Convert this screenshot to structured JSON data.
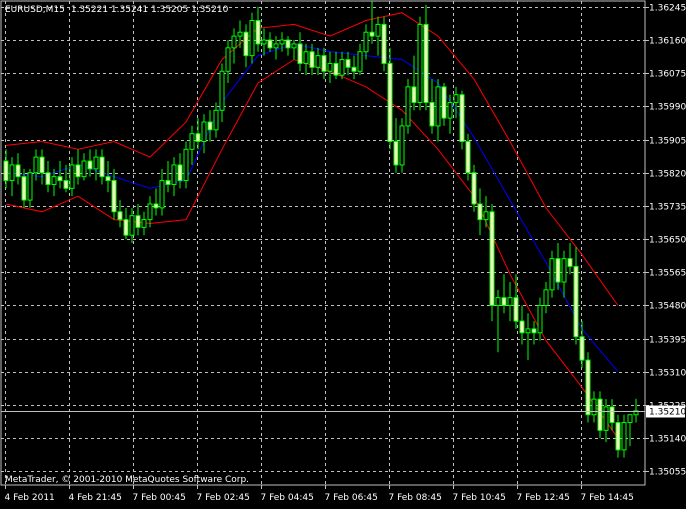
{
  "header": {
    "symbol": "EURUSD,M15",
    "ohlc": "1.35221 1.35241 1.35205 1.35210"
  },
  "copyright": "MetaTrader, © 2001-2010 MetaQuotes Software Corp.",
  "colors": {
    "background": "#000000",
    "grid": "#c0c0c0",
    "candle_bull": "#000000",
    "candle_bear": "#ffffc8",
    "wick": "#00ff00",
    "band": "#ff0000",
    "middle": "#0000ff",
    "axis_text": "#ffffff",
    "price_line": "#c0c0c0"
  },
  "chart_data": {
    "type": "candlestick",
    "grid": true,
    "ylim": [
      1.3502,
      1.3626
    ],
    "y_ticks": [
      "1.36245",
      "1.36160",
      "1.36075",
      "1.35990",
      "1.35905",
      "1.35820",
      "1.35735",
      "1.35650",
      "1.35565",
      "1.35480",
      "1.35395",
      "1.35310",
      "1.35225",
      "1.35140",
      "1.35055"
    ],
    "x_ticks": [
      "4 Feb 2011",
      "4 Feb 21:45",
      "7 Feb 00:45",
      "7 Feb 02:45",
      "7 Feb 04:45",
      "7 Feb 06:45",
      "7 Feb 08:45",
      "7 Feb 10:45",
      "7 Feb 12:45",
      "7 Feb 14:45"
    ],
    "current_price": "1.35210",
    "candles": [
      {
        "o": 1.3585,
        "h": 1.3588,
        "l": 1.3578,
        "c": 1.358
      },
      {
        "o": 1.358,
        "h": 1.3586,
        "l": 1.3576,
        "c": 1.3584
      },
      {
        "o": 1.3584,
        "h": 1.3587,
        "l": 1.3579,
        "c": 1.3581
      },
      {
        "o": 1.3581,
        "h": 1.3583,
        "l": 1.3573,
        "c": 1.3575
      },
      {
        "o": 1.3575,
        "h": 1.3583,
        "l": 1.3573,
        "c": 1.3582
      },
      {
        "o": 1.3582,
        "h": 1.3588,
        "l": 1.358,
        "c": 1.3586
      },
      {
        "o": 1.3586,
        "h": 1.3588,
        "l": 1.3579,
        "c": 1.3582
      },
      {
        "o": 1.3582,
        "h": 1.3585,
        "l": 1.3577,
        "c": 1.3579
      },
      {
        "o": 1.3579,
        "h": 1.3583,
        "l": 1.3576,
        "c": 1.3581
      },
      {
        "o": 1.3581,
        "h": 1.3585,
        "l": 1.3578,
        "c": 1.358
      },
      {
        "o": 1.358,
        "h": 1.3584,
        "l": 1.3577,
        "c": 1.3578
      },
      {
        "o": 1.3578,
        "h": 1.3586,
        "l": 1.3576,
        "c": 1.3584
      },
      {
        "o": 1.3584,
        "h": 1.3588,
        "l": 1.3579,
        "c": 1.3581
      },
      {
        "o": 1.3581,
        "h": 1.3587,
        "l": 1.358,
        "c": 1.3585
      },
      {
        "o": 1.3585,
        "h": 1.3588,
        "l": 1.3581,
        "c": 1.3583
      },
      {
        "o": 1.3583,
        "h": 1.3588,
        "l": 1.358,
        "c": 1.3586
      },
      {
        "o": 1.3586,
        "h": 1.3588,
        "l": 1.3579,
        "c": 1.3581
      },
      {
        "o": 1.3581,
        "h": 1.3585,
        "l": 1.3577,
        "c": 1.358
      },
      {
        "o": 1.358,
        "h": 1.3583,
        "l": 1.357,
        "c": 1.3572
      },
      {
        "o": 1.3572,
        "h": 1.3575,
        "l": 1.3568,
        "c": 1.357
      },
      {
        "o": 1.357,
        "h": 1.3573,
        "l": 1.3565,
        "c": 1.3566
      },
      {
        "o": 1.3566,
        "h": 1.3573,
        "l": 1.3564,
        "c": 1.3571
      },
      {
        "o": 1.3571,
        "h": 1.3574,
        "l": 1.3566,
        "c": 1.3568
      },
      {
        "o": 1.3568,
        "h": 1.3572,
        "l": 1.3566,
        "c": 1.357
      },
      {
        "o": 1.357,
        "h": 1.3576,
        "l": 1.3568,
        "c": 1.3574
      },
      {
        "o": 1.3574,
        "h": 1.3578,
        "l": 1.3571,
        "c": 1.3573
      },
      {
        "o": 1.3573,
        "h": 1.3583,
        "l": 1.3571,
        "c": 1.358
      },
      {
        "o": 1.358,
        "h": 1.3585,
        "l": 1.3577,
        "c": 1.3579
      },
      {
        "o": 1.3579,
        "h": 1.3586,
        "l": 1.3576,
        "c": 1.3584
      },
      {
        "o": 1.3584,
        "h": 1.3587,
        "l": 1.3578,
        "c": 1.358
      },
      {
        "o": 1.358,
        "h": 1.359,
        "l": 1.3578,
        "c": 1.3588
      },
      {
        "o": 1.3588,
        "h": 1.3594,
        "l": 1.3584,
        "c": 1.3592
      },
      {
        "o": 1.3592,
        "h": 1.3596,
        "l": 1.3588,
        "c": 1.359
      },
      {
        "o": 1.359,
        "h": 1.3597,
        "l": 1.3587,
        "c": 1.3595
      },
      {
        "o": 1.3595,
        "h": 1.3598,
        "l": 1.359,
        "c": 1.3593
      },
      {
        "o": 1.3593,
        "h": 1.36,
        "l": 1.3591,
        "c": 1.3598
      },
      {
        "o": 1.3598,
        "h": 1.361,
        "l": 1.3595,
        "c": 1.3608
      },
      {
        "o": 1.3608,
        "h": 1.3616,
        "l": 1.3605,
        "c": 1.3614
      },
      {
        "o": 1.3614,
        "h": 1.3619,
        "l": 1.361,
        "c": 1.3617
      },
      {
        "o": 1.3617,
        "h": 1.3621,
        "l": 1.3614,
        "c": 1.3618
      },
      {
        "o": 1.3618,
        "h": 1.362,
        "l": 1.3609,
        "c": 1.3612
      },
      {
        "o": 1.3612,
        "h": 1.3623,
        "l": 1.361,
        "c": 1.3621
      },
      {
        "o": 1.3621,
        "h": 1.36245,
        "l": 1.3613,
        "c": 1.3615
      },
      {
        "o": 1.3615,
        "h": 1.3619,
        "l": 1.3612,
        "c": 1.3616
      },
      {
        "o": 1.3616,
        "h": 1.3618,
        "l": 1.3613,
        "c": 1.3614
      },
      {
        "o": 1.3614,
        "h": 1.3617,
        "l": 1.3611,
        "c": 1.3615
      },
      {
        "o": 1.3615,
        "h": 1.3618,
        "l": 1.3613,
        "c": 1.3616
      },
      {
        "o": 1.3616,
        "h": 1.3617,
        "l": 1.3612,
        "c": 1.3614
      },
      {
        "o": 1.3614,
        "h": 1.3616,
        "l": 1.3611,
        "c": 1.3615
      },
      {
        "o": 1.3615,
        "h": 1.3618,
        "l": 1.3608,
        "c": 1.361
      },
      {
        "o": 1.361,
        "h": 1.3615,
        "l": 1.3607,
        "c": 1.3613
      },
      {
        "o": 1.3613,
        "h": 1.3615,
        "l": 1.3607,
        "c": 1.3609
      },
      {
        "o": 1.3609,
        "h": 1.3614,
        "l": 1.3607,
        "c": 1.3612
      },
      {
        "o": 1.3612,
        "h": 1.3614,
        "l": 1.3606,
        "c": 1.3608
      },
      {
        "o": 1.3608,
        "h": 1.3613,
        "l": 1.3605,
        "c": 1.361
      },
      {
        "o": 1.361,
        "h": 1.3613,
        "l": 1.3606,
        "c": 1.3607
      },
      {
        "o": 1.3607,
        "h": 1.3613,
        "l": 1.3606,
        "c": 1.3611
      },
      {
        "o": 1.3611,
        "h": 1.3613,
        "l": 1.3607,
        "c": 1.3609
      },
      {
        "o": 1.3609,
        "h": 1.3612,
        "l": 1.3606,
        "c": 1.3608
      },
      {
        "o": 1.3608,
        "h": 1.3615,
        "l": 1.3607,
        "c": 1.3613
      },
      {
        "o": 1.3613,
        "h": 1.362,
        "l": 1.3611,
        "c": 1.3618
      },
      {
        "o": 1.3618,
        "h": 1.3626,
        "l": 1.3615,
        "c": 1.3617
      },
      {
        "o": 1.3617,
        "h": 1.3622,
        "l": 1.3612,
        "c": 1.362
      },
      {
        "o": 1.362,
        "h": 1.3622,
        "l": 1.3608,
        "c": 1.361
      },
      {
        "o": 1.361,
        "h": 1.3614,
        "l": 1.3588,
        "c": 1.359
      },
      {
        "o": 1.359,
        "h": 1.3596,
        "l": 1.3582,
        "c": 1.3584
      },
      {
        "o": 1.3584,
        "h": 1.3596,
        "l": 1.3582,
        "c": 1.3594
      },
      {
        "o": 1.3594,
        "h": 1.3606,
        "l": 1.3592,
        "c": 1.3604
      },
      {
        "o": 1.3604,
        "h": 1.3612,
        "l": 1.3598,
        "c": 1.36
      },
      {
        "o": 1.36,
        "h": 1.3622,
        "l": 1.3598,
        "c": 1.362
      },
      {
        "o": 1.362,
        "h": 1.3625,
        "l": 1.3598,
        "c": 1.36
      },
      {
        "o": 1.36,
        "h": 1.3606,
        "l": 1.3592,
        "c": 1.3594
      },
      {
        "o": 1.3594,
        "h": 1.3606,
        "l": 1.359,
        "c": 1.3604
      },
      {
        "o": 1.3604,
        "h": 1.3605,
        "l": 1.3594,
        "c": 1.3596
      },
      {
        "o": 1.3596,
        "h": 1.3602,
        "l": 1.3592,
        "c": 1.36
      },
      {
        "o": 1.36,
        "h": 1.3604,
        "l": 1.3596,
        "c": 1.3602
      },
      {
        "o": 1.3602,
        "h": 1.3603,
        "l": 1.3588,
        "c": 1.359
      },
      {
        "o": 1.359,
        "h": 1.3592,
        "l": 1.358,
        "c": 1.3582
      },
      {
        "o": 1.3582,
        "h": 1.3584,
        "l": 1.3572,
        "c": 1.3574
      },
      {
        "o": 1.3574,
        "h": 1.3578,
        "l": 1.3566,
        "c": 1.357
      },
      {
        "o": 1.357,
        "h": 1.3576,
        "l": 1.3568,
        "c": 1.3572
      },
      {
        "o": 1.3572,
        "h": 1.3574,
        "l": 1.3544,
        "c": 1.3548
      },
      {
        "o": 1.3548,
        "h": 1.3552,
        "l": 1.3536,
        "c": 1.355
      },
      {
        "o": 1.355,
        "h": 1.3556,
        "l": 1.3546,
        "c": 1.3548
      },
      {
        "o": 1.3548,
        "h": 1.3554,
        "l": 1.3544,
        "c": 1.355
      },
      {
        "o": 1.355,
        "h": 1.3556,
        "l": 1.3542,
        "c": 1.3544
      },
      {
        "o": 1.3544,
        "h": 1.3548,
        "l": 1.3538,
        "c": 1.3541
      },
      {
        "o": 1.3541,
        "h": 1.3546,
        "l": 1.3534,
        "c": 1.3542
      },
      {
        "o": 1.3542,
        "h": 1.3544,
        "l": 1.3538,
        "c": 1.3541
      },
      {
        "o": 1.3541,
        "h": 1.355,
        "l": 1.3539,
        "c": 1.3548
      },
      {
        "o": 1.3548,
        "h": 1.3554,
        "l": 1.3546,
        "c": 1.3552
      },
      {
        "o": 1.3552,
        "h": 1.3562,
        "l": 1.355,
        "c": 1.356
      },
      {
        "o": 1.356,
        "h": 1.3564,
        "l": 1.3552,
        "c": 1.3554
      },
      {
        "o": 1.3554,
        "h": 1.3562,
        "l": 1.355,
        "c": 1.356
      },
      {
        "o": 1.356,
        "h": 1.3564,
        "l": 1.3556,
        "c": 1.3558
      },
      {
        "o": 1.3558,
        "h": 1.3563,
        "l": 1.3538,
        "c": 1.354
      },
      {
        "o": 1.354,
        "h": 1.3544,
        "l": 1.3532,
        "c": 1.3534
      },
      {
        "o": 1.3534,
        "h": 1.3536,
        "l": 1.3518,
        "c": 1.352
      },
      {
        "o": 1.352,
        "h": 1.3526,
        "l": 1.3518,
        "c": 1.3524
      },
      {
        "o": 1.3524,
        "h": 1.3526,
        "l": 1.3514,
        "c": 1.3516
      },
      {
        "o": 1.3516,
        "h": 1.3524,
        "l": 1.3513,
        "c": 1.3522
      },
      {
        "o": 1.3522,
        "h": 1.3524,
        "l": 1.3516,
        "c": 1.3518
      },
      {
        "o": 1.3518,
        "h": 1.352,
        "l": 1.3509,
        "c": 1.3511
      },
      {
        "o": 1.3511,
        "h": 1.352,
        "l": 1.3509,
        "c": 1.3518
      },
      {
        "o": 1.3518,
        "h": 1.352,
        "l": 1.3512,
        "c": 1.352
      },
      {
        "o": 1.352,
        "h": 1.35241,
        "l": 1.3518,
        "c": 1.3521
      }
    ],
    "series": [
      {
        "name": "",
        "color": "#ff0000",
        "points": [
          [
            0,
            1.3589
          ],
          [
            6,
            1.359
          ],
          [
            12,
            1.3588
          ],
          [
            18,
            1.359
          ],
          [
            24,
            1.3586
          ],
          [
            30,
            1.3595
          ],
          [
            36,
            1.3611
          ],
          [
            42,
            1.3619
          ],
          [
            48,
            1.362
          ],
          [
            54,
            1.3617
          ],
          [
            60,
            1.3621
          ],
          [
            66,
            1.3623
          ],
          [
            72,
            1.3617
          ],
          [
            78,
            1.3606
          ],
          [
            84,
            1.359
          ],
          [
            90,
            1.3573
          ],
          [
            96,
            1.3561
          ],
          [
            102,
            1.3548
          ]
        ]
      },
      {
        "name": "",
        "color": "#0000ff",
        "points": [
          [
            0,
            1.3582
          ],
          [
            6,
            1.3581
          ],
          [
            12,
            1.3584
          ],
          [
            18,
            1.3581
          ],
          [
            24,
            1.3578
          ],
          [
            30,
            1.358
          ],
          [
            36,
            1.36
          ],
          [
            42,
            1.3612
          ],
          [
            48,
            1.3615
          ],
          [
            54,
            1.3613
          ],
          [
            60,
            1.3612
          ],
          [
            66,
            1.3611
          ],
          [
            72,
            1.3605
          ],
          [
            78,
            1.3591
          ],
          [
            84,
            1.3575
          ],
          [
            90,
            1.3559
          ],
          [
            96,
            1.3542
          ],
          [
            102,
            1.3531
          ]
        ]
      },
      {
        "name": "",
        "color": "#ff0000",
        "points": [
          [
            0,
            1.3574
          ],
          [
            6,
            1.3572
          ],
          [
            12,
            1.3576
          ],
          [
            18,
            1.357
          ],
          [
            24,
            1.3569
          ],
          [
            30,
            1.357
          ],
          [
            36,
            1.3588
          ],
          [
            42,
            1.3605
          ],
          [
            48,
            1.3611
          ],
          [
            54,
            1.3608
          ],
          [
            60,
            1.3604
          ],
          [
            66,
            1.3598
          ],
          [
            72,
            1.3588
          ],
          [
            78,
            1.3576
          ],
          [
            84,
            1.3556
          ],
          [
            90,
            1.3539
          ],
          [
            96,
            1.3527
          ],
          [
            102,
            1.3514
          ]
        ]
      }
    ]
  }
}
